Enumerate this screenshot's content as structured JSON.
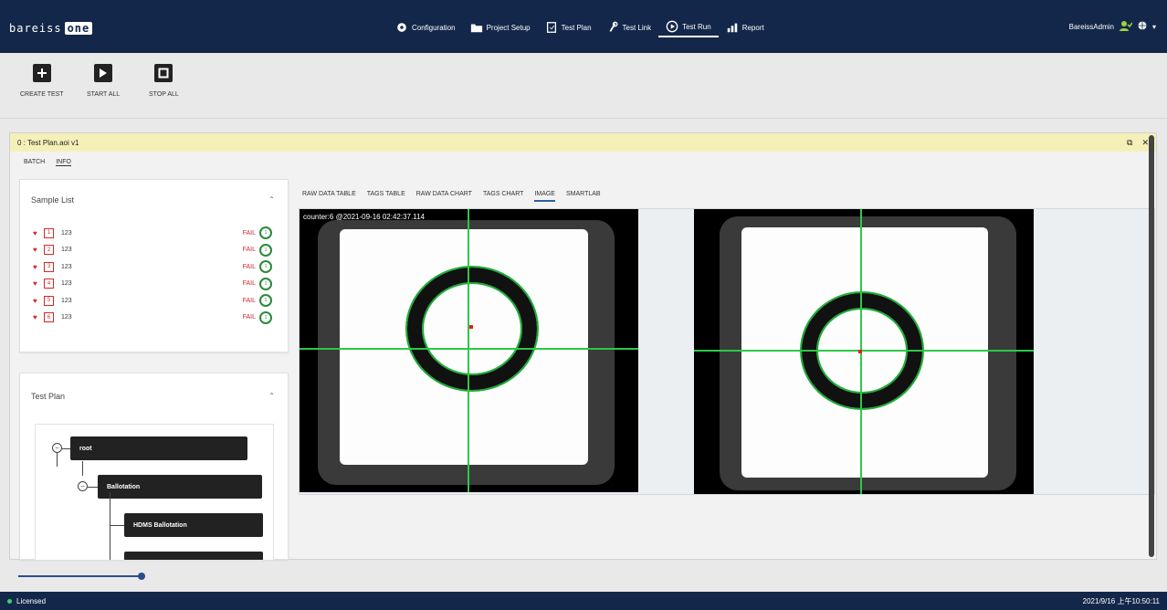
{
  "header": {
    "logo_text": "bareiss",
    "logo_badge": "one",
    "nav": [
      {
        "label": "Configuration",
        "icon": "gear-icon"
      },
      {
        "label": "Project Setup",
        "icon": "folder-icon"
      },
      {
        "label": "Test Plan",
        "icon": "clipboard-icon"
      },
      {
        "label": "Test Link",
        "icon": "link-icon"
      },
      {
        "label": "Test Run",
        "icon": "play-circle-icon"
      },
      {
        "label": "Report",
        "icon": "bar-chart-icon"
      }
    ],
    "active_nav": "Test Run",
    "user": "BareissAdmin"
  },
  "toolbar": {
    "create": "CREATE TEST",
    "start": "START ALL",
    "stop": "STOP ALL"
  },
  "panel": {
    "title": "0 : Test Plan.aoi v1",
    "tabs": [
      "BATCH",
      "INFO"
    ],
    "active_tab": "INFO"
  },
  "sample_list": {
    "title": "Sample List",
    "rows": [
      {
        "index": "1",
        "value": "123",
        "status": "FAIL",
        "ring": "1"
      },
      {
        "index": "2",
        "value": "123",
        "status": "FAIL",
        "ring": "1"
      },
      {
        "index": "3",
        "value": "123",
        "status": "FAIL",
        "ring": "1"
      },
      {
        "index": "4",
        "value": "123",
        "status": "FAIL",
        "ring": "1"
      },
      {
        "index": "5",
        "value": "123",
        "status": "FAIL",
        "ring": "1"
      },
      {
        "index": "6",
        "value": "123",
        "status": "FAIL",
        "ring": "1"
      }
    ]
  },
  "test_plan": {
    "title": "Test Plan",
    "nodes": [
      "root",
      "Ballotation",
      "HDMS Ballotation"
    ]
  },
  "data_tabs": [
    "RAW DATA TABLE",
    "TAGS TABLE",
    "RAW DATA CHART",
    "TAGS CHART",
    "IMAGE",
    "SMARTLAB"
  ],
  "active_data_tab": "IMAGE",
  "image": {
    "caption": "counter:6 @2021-09-16 02:42:37.114"
  },
  "status": {
    "license": "Licensed",
    "datetime": "2021/9/16 上午10:50:11"
  },
  "colors": {
    "nav_bg": "#13274a",
    "fail": "#d12a2a",
    "ok_ring": "#2a8a3a",
    "crosshair": "#2ec74a",
    "panel_header": "#f5f0b8"
  }
}
